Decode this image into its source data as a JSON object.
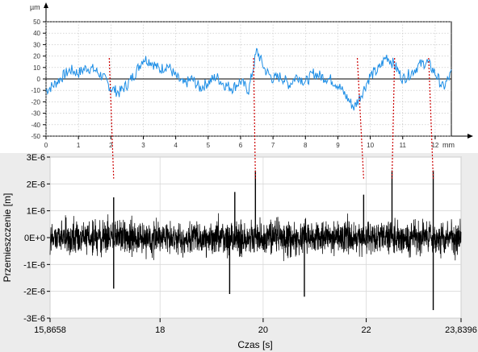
{
  "chart_data": [
    {
      "type": "line",
      "title": "",
      "unit_label": "µm",
      "x_unit": "mm",
      "xlim": [
        0,
        12.5
      ],
      "ylim": [
        -50,
        50
      ],
      "x_ticks": [
        0,
        1,
        2,
        3,
        4,
        5,
        6,
        7,
        8,
        9,
        10,
        11,
        12
      ],
      "x_tick_labels": [
        "0",
        "1",
        "2",
        "3",
        "4",
        "5",
        "6",
        "7",
        "8",
        "9",
        "10",
        "11",
        "12"
      ],
      "y_ticks": [
        50,
        40,
        30,
        20,
        10,
        0,
        -10,
        -20,
        -30,
        -40,
        -50
      ],
      "y_tick_labels": [
        "50",
        "40",
        "30",
        "20",
        "10",
        "0",
        "-10",
        "-20",
        "-30",
        "-40",
        "-50"
      ],
      "grid": true,
      "series": [
        {
          "color": "#1f8fe6",
          "x": [
            0,
            0.25,
            0.5,
            0.75,
            1,
            1.25,
            1.5,
            1.75,
            2,
            2.25,
            2.5,
            2.75,
            3,
            3.25,
            3.5,
            3.75,
            4,
            4.25,
            4.5,
            4.75,
            5,
            5.25,
            5.5,
            5.75,
            6,
            6.25,
            6.5,
            6.75,
            7,
            7.25,
            7.5,
            7.75,
            8,
            8.25,
            8.5,
            8.75,
            9,
            9.25,
            9.5,
            9.75,
            10,
            10.25,
            10.5,
            10.75,
            11,
            11.25,
            11.5,
            11.75,
            12,
            12.25,
            12.5
          ],
          "values": [
            -10,
            -5,
            2,
            8,
            5,
            10,
            8,
            2,
            -8,
            -12,
            -5,
            5,
            18,
            15,
            8,
            12,
            2,
            -5,
            0,
            -8,
            -3,
            2,
            -5,
            -8,
            -2,
            -10,
            25,
            8,
            0,
            2,
            -5,
            3,
            -3,
            5,
            2,
            0,
            -5,
            -15,
            -25,
            -12,
            3,
            8,
            20,
            12,
            0,
            5,
            12,
            15,
            5,
            -8,
            5
          ]
        }
      ]
    },
    {
      "type": "line",
      "title": "",
      "xlabel": "Czas [s]",
      "ylabel": "Przemieszczenie [m]",
      "xlim": [
        15.8658,
        23.8396
      ],
      "ylim": [
        -3e-06,
        3e-06
      ],
      "x_ticks": [
        15.8658,
        18,
        20,
        22,
        23.8396
      ],
      "x_tick_labels": [
        "15,8658",
        "18",
        "20",
        "22",
        "23,8396"
      ],
      "y_ticks": [
        3e-06,
        2e-06,
        1e-06,
        0,
        -1e-06,
        -2e-06,
        -3e-06
      ],
      "y_tick_labels": [
        "3E-6",
        "2E-6",
        "1E-6",
        "0E+0",
        "-1E-6",
        "-2E-6",
        "-3E-6"
      ],
      "grid": true,
      "series": [
        {
          "color": "#000000",
          "description_of_signal": "dense broadband noise centered at 0",
          "peaks_x": [
            17.1,
            19.45,
            19.85,
            21.95,
            22.5,
            23.3
          ],
          "peaks_y": [
            1.5e-06,
            1.7e-06,
            2.5e-06,
            1.6e-06,
            2.5e-06,
            2.5e-06
          ],
          "troughs_x": [
            17.1,
            19.35,
            20.8,
            23.3
          ],
          "troughs_y": [
            -1.9e-06,
            -2.1e-06,
            -2.2e-06,
            -2.7e-06
          ]
        }
      ]
    }
  ],
  "connectors": [
    {
      "from_x_mm": 1.95,
      "to_time_s": 17.1
    },
    {
      "from_x_mm": 6.4,
      "to_time_s": 19.85
    },
    {
      "from_x_mm": 9.6,
      "to_time_s": 21.95
    },
    {
      "from_x_mm": 10.75,
      "to_time_s": 22.5
    },
    {
      "from_x_mm": 11.8,
      "to_time_s": 23.3
    }
  ],
  "colors": {
    "top_line": "#1f8fe6",
    "bottom_line": "#000000",
    "connector": "#cc0000",
    "bottom_panel_bg": "#ececec",
    "bottom_plot_bg": "#ffffff"
  }
}
